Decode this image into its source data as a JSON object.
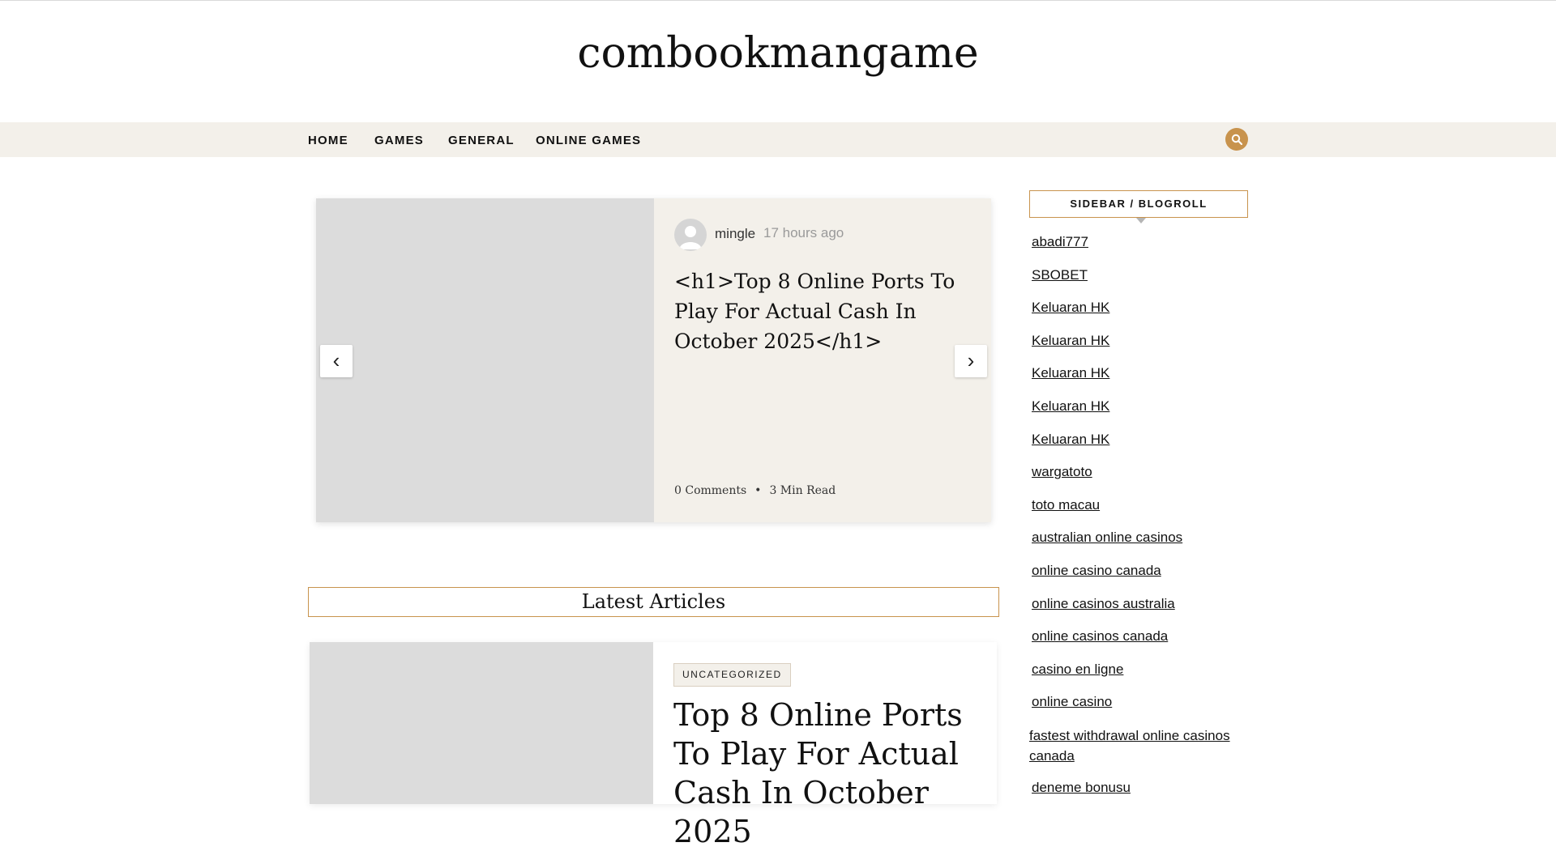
{
  "site": {
    "title": "combookmangame"
  },
  "nav": {
    "items": [
      "HOME",
      "GAMES",
      "GENERAL",
      "ONLINE GAMES"
    ],
    "search_icon": "search-icon"
  },
  "slider": {
    "author": "mingle",
    "time_ago": "17 hours ago",
    "title": "<h1>Top 8 Online Ports To Play For Actual Cash In October 2025</h1>",
    "comments": "0 Comments",
    "read_time": "3 Min Read",
    "prev_label": "‹",
    "next_label": "›"
  },
  "latest": {
    "heading": "Latest Articles",
    "article": {
      "category": "UNCATEGORIZED",
      "title": "Top 8 Online Ports To Play For Actual Cash In October 2025"
    }
  },
  "sidebar": {
    "heading": "SIDEBAR / BLOGROLL",
    "links": [
      "abadi777",
      "SBOBET",
      "Keluaran HK",
      "Keluaran HK",
      "Keluaran HK",
      "Keluaran HK",
      "Keluaran HK",
      "wargatoto",
      "toto macau",
      "australian online casinos",
      "online casino canada",
      "online casinos australia",
      "online casinos canada",
      "casino en ligne",
      "online casino",
      "fastest withdrawal online casinos canada",
      "deneme bonusu"
    ]
  },
  "colors": {
    "accent": "#c8934d",
    "nav_bg": "#f3f0ea",
    "placeholder": "#dcdcdc"
  }
}
